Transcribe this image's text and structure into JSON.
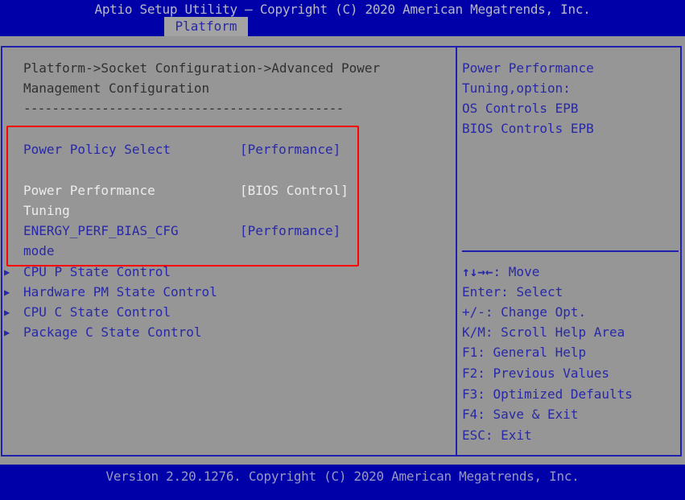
{
  "header": {
    "title": "Aptio Setup Utility – Copyright (C) 2020 American Megatrends, Inc.",
    "active_tab": "Platform"
  },
  "main": {
    "breadcrumb_line1": "Platform->Socket Configuration->Advanced Power",
    "breadcrumb_line2": "Management Configuration",
    "separator": "---------------------------------------------",
    "settings": [
      {
        "label_line1": "Power Policy Select",
        "label_line2": "",
        "value": "[Performance]",
        "state": "normal"
      },
      {
        "label_line1": "Power Performance",
        "label_line2": "Tuning",
        "value": "[BIOS Control]",
        "state": "selected"
      },
      {
        "label_line1": "ENERGY_PERF_BIAS_CFG",
        "label_line2": "mode",
        "value": "[Performance]",
        "state": "normal"
      }
    ],
    "submenus": [
      {
        "label": "CPU P State Control"
      },
      {
        "label": "Hardware PM State Control"
      },
      {
        "label": "CPU C State Control"
      },
      {
        "label": "Package C State Control"
      }
    ]
  },
  "help": {
    "lines": [
      "Power Performance",
      "Tuning,option:",
      "OS Controls EPB",
      "BIOS Controls EPB"
    ]
  },
  "keys": [
    {
      "key": "↑↓→←",
      "desc": ": Move"
    },
    {
      "key": "Enter",
      "desc": ": Select"
    },
    {
      "key": "+/-",
      "desc": ": Change Opt."
    },
    {
      "key": "K/M",
      "desc": ": Scroll Help Area"
    },
    {
      "key": "F1",
      "desc": ": General Help"
    },
    {
      "key": "F2",
      "desc": ": Previous Values"
    },
    {
      "key": "F3",
      "desc": ": Optimized Defaults"
    },
    {
      "key": "F4",
      "desc": ": Save & Exit"
    },
    {
      "key": "ESC",
      "desc": ": Exit"
    }
  ],
  "footer": {
    "version": "Version 2.20.1276. Copyright (C) 2020 American Megatrends, Inc."
  },
  "colors": {
    "bar_blue": "#0000a8",
    "panel_gray": "#969696",
    "text_blue": "#2828a8",
    "selected_white": "#ececec",
    "highlight_red": "#ff0000"
  }
}
